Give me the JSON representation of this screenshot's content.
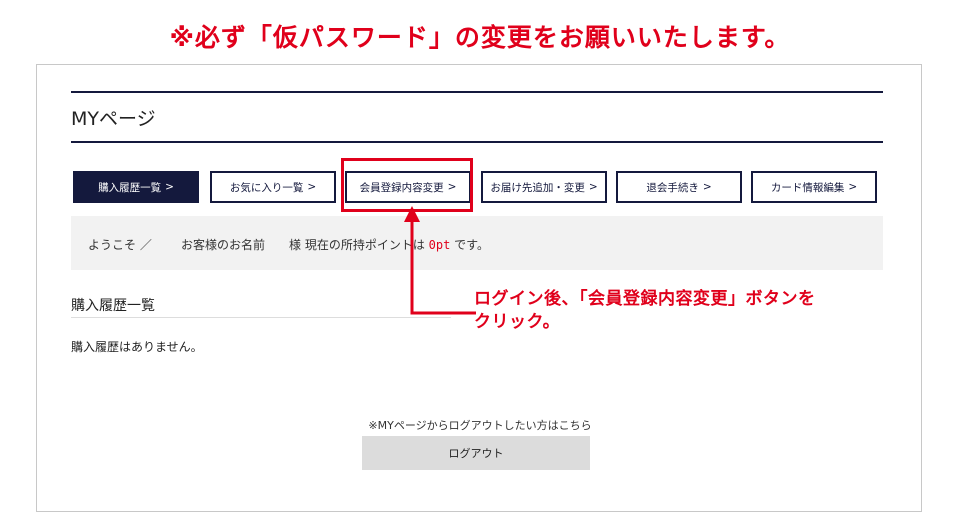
{
  "headline": "※必ず「仮パスワード」の変更をお願いいたします。",
  "page_title": "MYページ",
  "tabs": [
    {
      "label": "購入履歴一覧",
      "active": true
    },
    {
      "label": "お気に入り一覧",
      "active": false
    },
    {
      "label": "会員登録内容変更",
      "active": false,
      "highlighted": true
    },
    {
      "label": "お届け先追加・変更",
      "active": false
    },
    {
      "label": "退会手続き",
      "active": false
    },
    {
      "label": "カード情報編集",
      "active": false
    }
  ],
  "tab_chevron": ">",
  "welcome": {
    "greeting": "ようこそ ／",
    "customer_name": "お客様のお名前",
    "text_before_points": "様 現在の所持ポイントは",
    "points": "0pt",
    "text_after_points": "です。"
  },
  "purchase_history": {
    "heading": "購入履歴一覧",
    "empty_message": "購入履歴はありません。"
  },
  "logout": {
    "note": "※MYページからログアウトしたい方はこちら",
    "button_label": "ログアウト"
  },
  "annotation": {
    "line1": "ログイン後、「会員登録内容変更」ボタンを",
    "line2": "クリック。"
  },
  "colors": {
    "accent_red": "#e0001b",
    "navy": "#14193d",
    "panel_gray": "#f2f2f2",
    "button_gray": "#dcdcdc"
  }
}
